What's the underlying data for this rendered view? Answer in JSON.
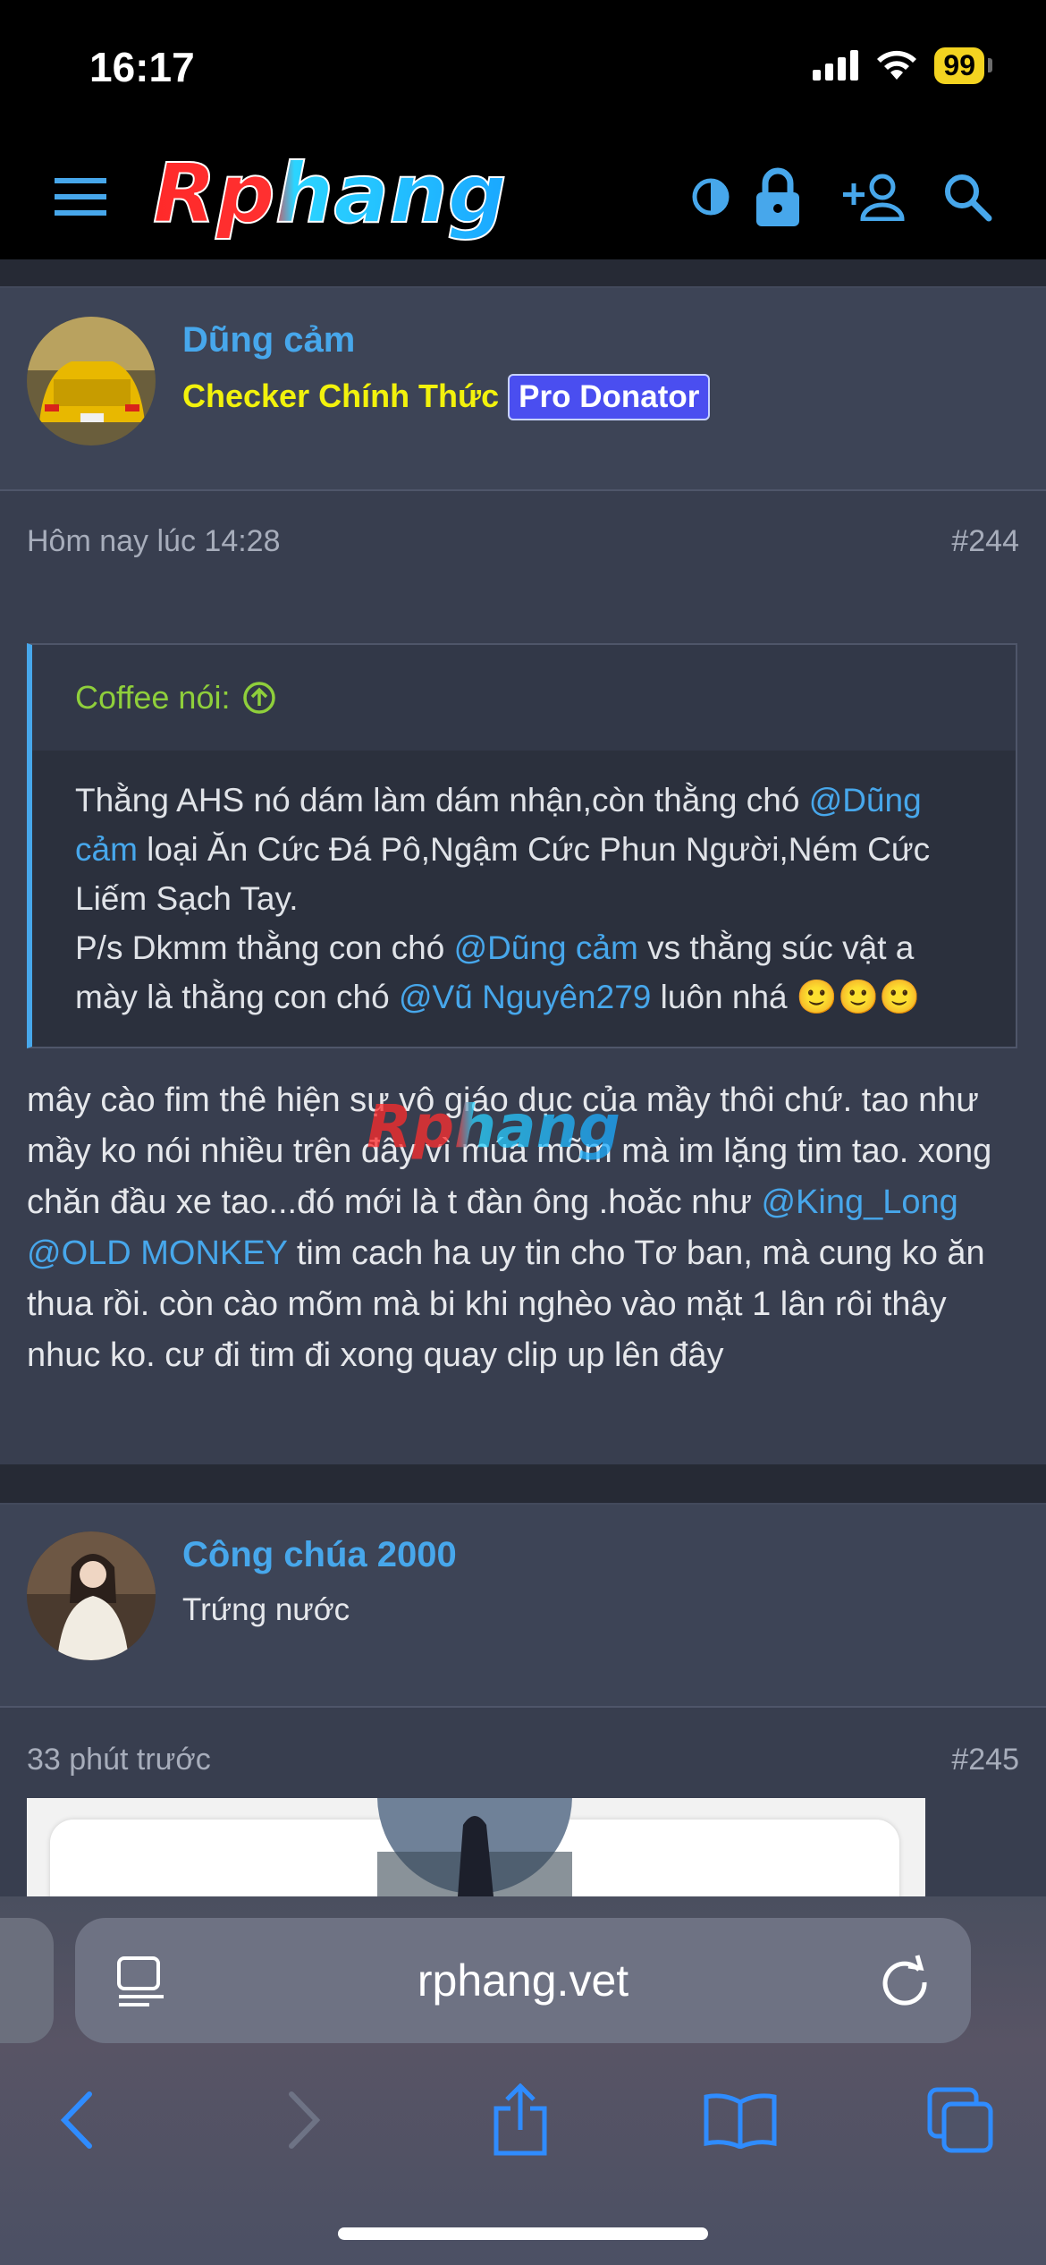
{
  "status_bar": {
    "time": "16:17",
    "battery": "99"
  },
  "site": {
    "logo_text": "Rphang",
    "watermark_text": "Rphang"
  },
  "posts": [
    {
      "username": "Dũng cảm",
      "user_title": "Checker Chính Thức",
      "badge": "Pro Donator",
      "timestamp": "Hôm nay lúc 14:28",
      "number": "#244",
      "quote": {
        "author_label": "Coffee nói:",
        "line1_a": "Thằng AHS nó dám làm dám nhận,còn thằng chó ",
        "mention1": "@Dũng cảm",
        "line1_b": " loại Ăn Cức Đá Pô,Ngậm Cức Phun Người,Ném Cức Liếm Sạch Tay.",
        "line2_a": "P/s Dkmm thằng con chó ",
        "mention2": "@Dũng cảm",
        "line2_b": " vs thằng súc vật a mày là thằng con chó ",
        "mention3": "@Vũ Nguyên279",
        "line2_c": " luôn nhá ",
        "emoji": "🙂🙂🙂"
      },
      "body": {
        "text_a": "mây cào fim thê hiện sự vô giáo dục của mầy thôi chứ. tao như mầy ko nói nhiều trên đây vì múa mõm mà im lặng tim tao. xong chăn đầu xe tao...đó mới là t đàn ông .hoăc như ",
        "mention1": "@King_Long",
        "text_b": " ",
        "mention2": "@OLD MONKEY",
        "text_c": " tim cach ha uy tin cho Tơ ban, mà cung ko ăn thua rồi. còn cào mõm mà bi khi nghèo vào mặt 1 lân rôi thây nhuc ko. cư đi tim đi xong quay clip up lên đây"
      }
    },
    {
      "username": "Công chúa 2000",
      "user_title": "Trứng nước",
      "timestamp": "33 phút trước",
      "number": "#245"
    }
  ],
  "browser": {
    "url": "rphang.vet"
  },
  "colors": {
    "link": "#47a7eb",
    "title_yellow": "#f2f20c",
    "quote_author": "#8fcf3b",
    "badge": "#4a4ef0"
  },
  "icons": [
    "menu-icon",
    "contrast-icon",
    "lock-icon",
    "add-user-icon",
    "search-icon",
    "reader-icon",
    "reload-icon",
    "back-icon",
    "forward-icon",
    "share-icon",
    "bookmarks-icon",
    "tabs-icon"
  ]
}
